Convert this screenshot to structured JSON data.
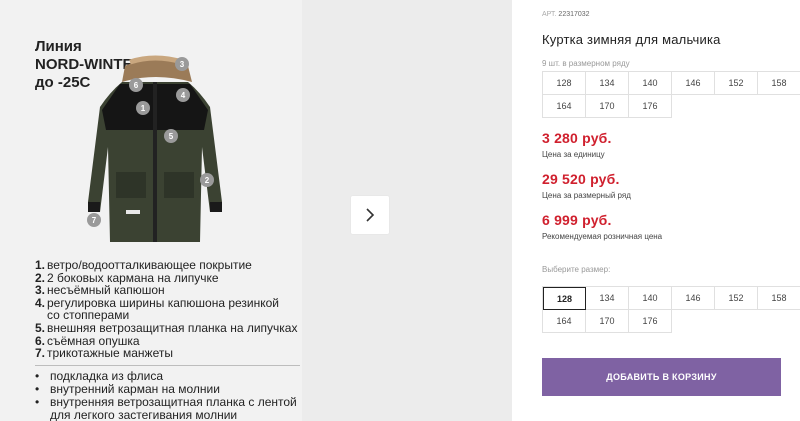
{
  "product_card": {
    "line_title": [
      "Линия",
      "NORD-WINTER",
      "до -25С"
    ],
    "features": [
      {
        "num": "1.",
        "text": "ветро/водоотталкивающее покрытие"
      },
      {
        "num": "2.",
        "text": "2 боковых кармана на липучке"
      },
      {
        "num": "3.",
        "text": "несъёмный капюшон"
      },
      {
        "num": "4.",
        "text": "регулировка ширины капюшона  резинкой"
      },
      {
        "num": "",
        "text": "со стопперами"
      },
      {
        "num": "5.",
        "text": "внешняя ветрозащитная планка на липучках"
      },
      {
        "num": "6.",
        "text": "съёмная опушка"
      },
      {
        "num": "7.",
        "text": "трикотажные манжеты"
      }
    ],
    "bullets": [
      {
        "dot": "•",
        "text": "подкладка из флиса"
      },
      {
        "dot": "•",
        "text": "внутренний карман на молнии"
      },
      {
        "dot": "•",
        "text": "внутренняя ветрозащитная планка с лентой"
      },
      {
        "dot": "",
        "text": "для легкого застегивания молнии"
      }
    ],
    "markers": [
      "1",
      "2",
      "3",
      "4",
      "5",
      "6",
      "7"
    ],
    "jacket_color": "#3b4232"
  },
  "gallery": {
    "next_icon": "chevron-right-icon"
  },
  "info": {
    "art_label": "АРТ.",
    "art_value": "22317032",
    "title": "Куртка зимняя для мальчика",
    "row_note": "9 шт. в размерном ряду",
    "sizes_row": [
      "128",
      "134",
      "140",
      "146",
      "152",
      "158",
      "164",
      "170",
      "176"
    ],
    "price_unit": "3 280 руб.",
    "price_unit_label": "Цена за единицу",
    "price_row": "29 520 руб.",
    "price_row_label": "Цена за размерный ряд",
    "price_retail": "6 999 руб.",
    "price_retail_label": "Рекомендуемая розничная цена",
    "choose_label": "Выберите размер:",
    "size_options": [
      "128",
      "134",
      "140",
      "146",
      "152",
      "158",
      "164",
      "170",
      "176"
    ],
    "selected_size": "128",
    "add_button": "ДОБАВИТЬ В КОРЗИНУ",
    "accent_color": "#7f62a3",
    "price_color": "#d0202e"
  }
}
